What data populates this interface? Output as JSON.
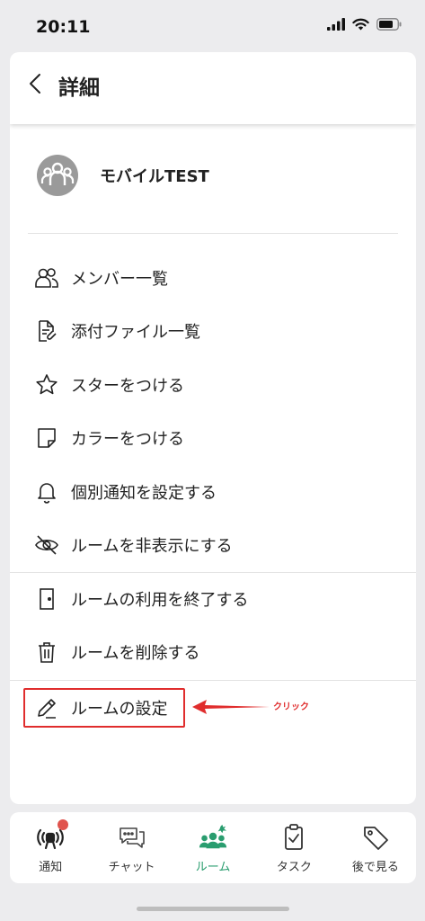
{
  "status_bar": {
    "time": "20:11"
  },
  "header": {
    "title": "詳細"
  },
  "room": {
    "name": "モバイルTEST"
  },
  "menu": [
    {
      "label": "メンバー一覧",
      "icon": "members-icon"
    },
    {
      "label": "添付ファイル一覧",
      "icon": "attachment-file-icon"
    },
    {
      "label": "スターをつける",
      "icon": "star-icon"
    },
    {
      "label": "カラーをつける",
      "icon": "color-tag-icon"
    },
    {
      "label": "個別通知を設定する",
      "icon": "bell-icon"
    },
    {
      "label": "ルームを非表示にする",
      "icon": "eye-off-icon"
    },
    {
      "label": "ルームの利用を終了する",
      "icon": "exit-door-icon"
    },
    {
      "label": "ルームを削除する",
      "icon": "trash-icon"
    },
    {
      "label": "ルームの設定",
      "icon": "pencil-icon"
    }
  ],
  "annotation": {
    "text": "クリック",
    "color": "#e02d2d"
  },
  "tab_bar": {
    "tabs": [
      {
        "label": "通知",
        "icon": "notification-icon",
        "has_badge": true
      },
      {
        "label": "チャット",
        "icon": "chat-icon"
      },
      {
        "label": "ルーム",
        "icon": "room-icon",
        "active": true
      },
      {
        "label": "タスク",
        "icon": "task-icon"
      },
      {
        "label": "後で見る",
        "icon": "tag-icon"
      }
    ],
    "active_color": "#2a9d6f",
    "badge_color": "#e0534d"
  }
}
